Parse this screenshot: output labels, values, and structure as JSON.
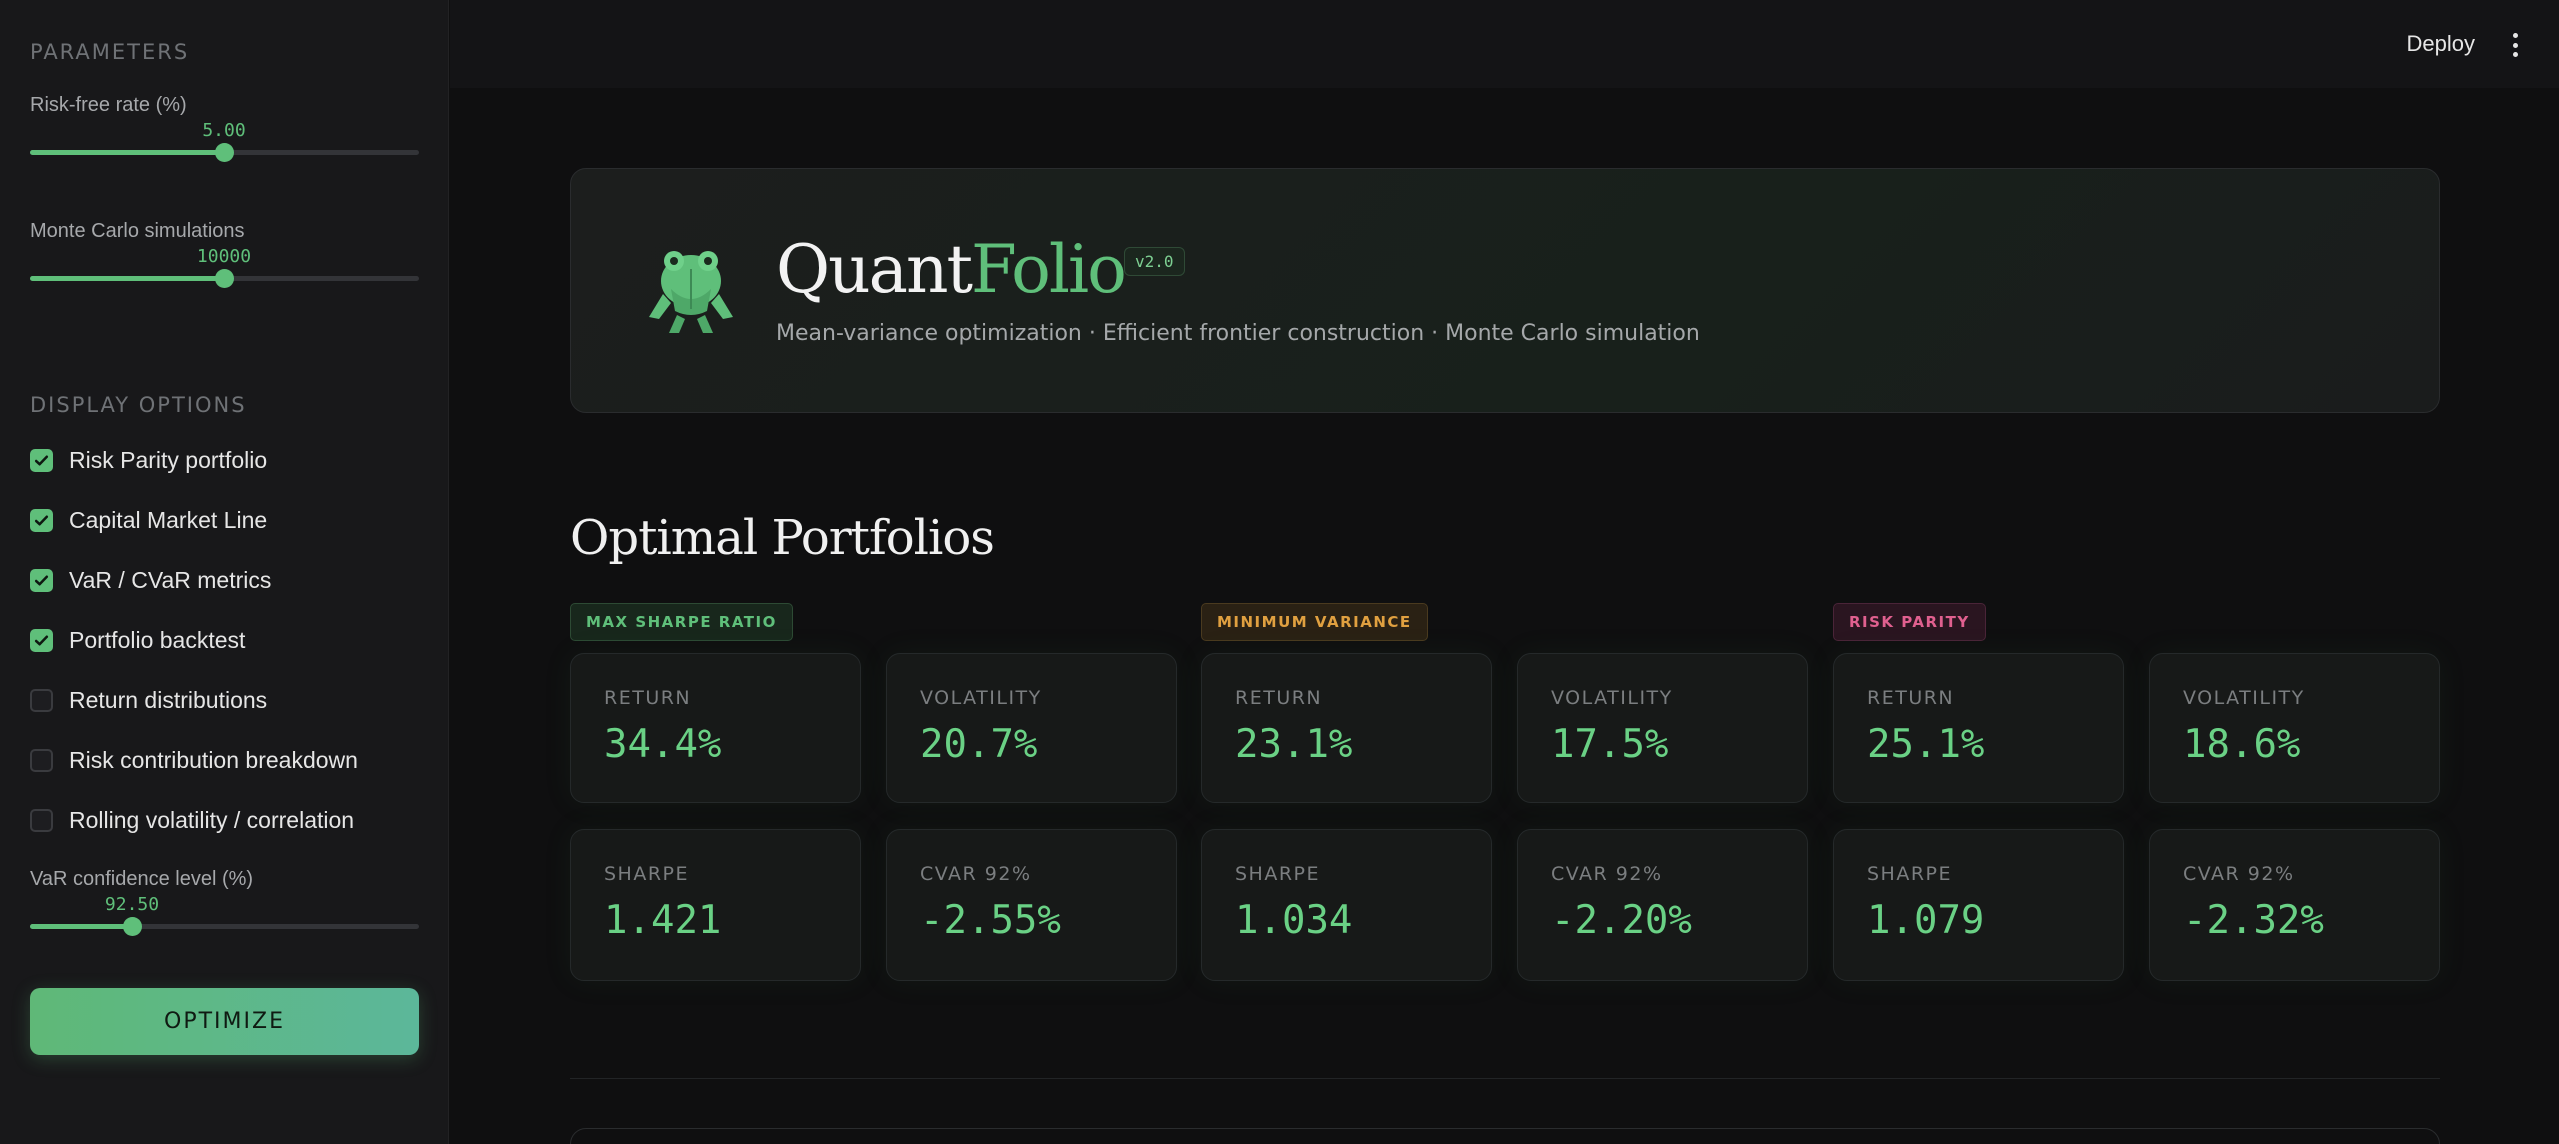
{
  "sidebar": {
    "parameters_title": "PARAMETERS",
    "risk_free": {
      "label": "Risk-free rate (%)",
      "value": "5.00",
      "fraction": 0.5
    },
    "monte_carlo": {
      "label": "Monte Carlo simulations",
      "value": "10000",
      "fraction": 0.5
    },
    "display_title": "DISPLAY OPTIONS",
    "options": [
      {
        "label": "Risk Parity portfolio",
        "checked": true
      },
      {
        "label": "Capital Market Line",
        "checked": true
      },
      {
        "label": "VaR / CVaR metrics",
        "checked": true
      },
      {
        "label": "Portfolio backtest",
        "checked": true
      },
      {
        "label": "Return distributions",
        "checked": false
      },
      {
        "label": "Risk contribution breakdown",
        "checked": false
      },
      {
        "label": "Rolling volatility / correlation",
        "checked": false
      }
    ],
    "var_conf": {
      "label": "VaR confidence level (%)",
      "value": "92.50",
      "fraction": 0.26
    },
    "optimize_label": "OPTIMIZE"
  },
  "topbar": {
    "deploy_label": "Deploy",
    "menu_icon": "kebab-menu-icon"
  },
  "hero": {
    "brand_a": "Quant",
    "brand_b": "Folio",
    "version": "v2.0",
    "tagline": "Mean-variance optimization · Efficient frontier construction · Monte Carlo simulation",
    "logo_icon": "frog-icon"
  },
  "section": {
    "title": "Optimal Portfolios"
  },
  "portfolios": [
    {
      "tag": "MAX SHARPE RATIO",
      "color": "#5fbf7a",
      "return_label": "RETURN",
      "return": "34.4%",
      "vol_label": "VOLATILITY",
      "vol": "20.7%",
      "sharpe_label": "SHARPE",
      "sharpe": "1.421",
      "cvar_label": "CVAR 92%",
      "cvar": "-2.55%"
    },
    {
      "tag": "MINIMUM VARIANCE",
      "color": "#e0a040",
      "return_label": "RETURN",
      "return": "23.1%",
      "vol_label": "VOLATILITY",
      "vol": "17.5%",
      "sharpe_label": "SHARPE",
      "sharpe": "1.034",
      "cvar_label": "CVAR 92%",
      "cvar": "-2.20%"
    },
    {
      "tag": "RISK PARITY",
      "color": "#e0608f",
      "return_label": "RETURN",
      "return": "25.1%",
      "vol_label": "VOLATILITY",
      "vol": "18.6%",
      "sharpe_label": "SHARPE",
      "sharpe": "1.079",
      "cvar_label": "CVAR 92%",
      "cvar": "-2.32%"
    }
  ]
}
